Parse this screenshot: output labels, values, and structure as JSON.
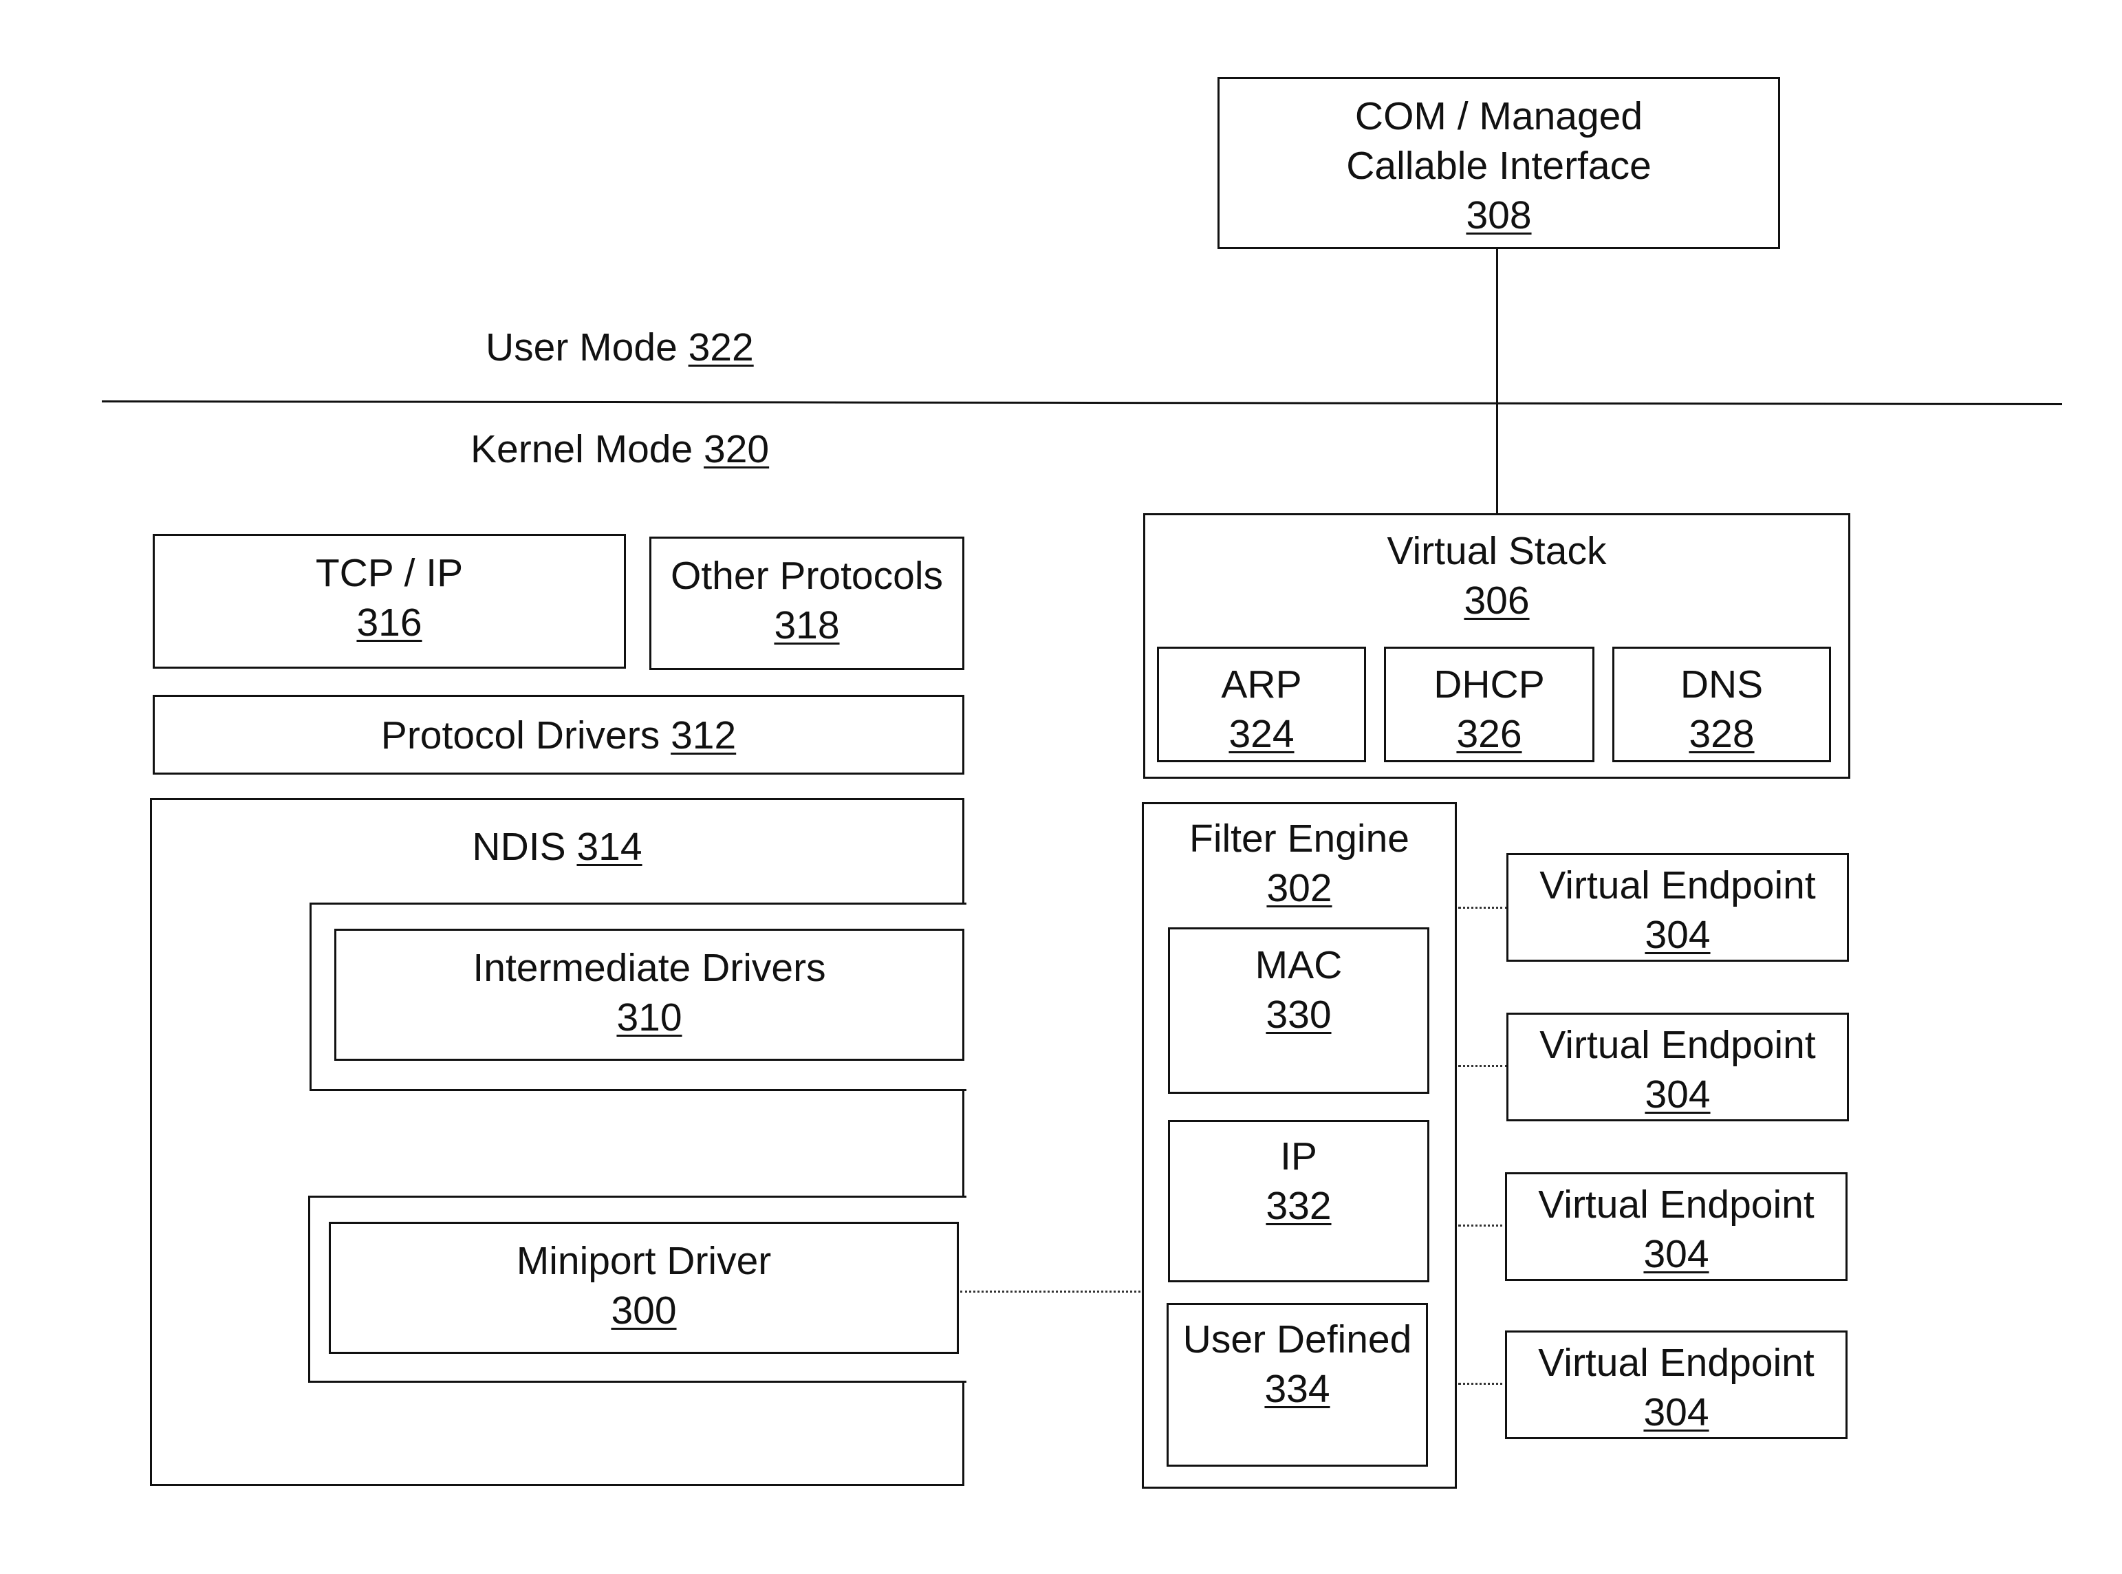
{
  "modes": {
    "user": {
      "label": "User Mode",
      "ref": "322"
    },
    "kernel": {
      "label": "Kernel Mode",
      "ref": "320"
    }
  },
  "com_interface": {
    "line1": "COM / Managed",
    "line2": "Callable Interface",
    "ref": "308"
  },
  "tcpip": {
    "label": "TCP / IP",
    "ref": "316"
  },
  "other_protocols": {
    "label": "Other Protocols",
    "ref": "318"
  },
  "protocol_drivers": {
    "label": "Protocol Drivers",
    "ref": "312"
  },
  "ndis": {
    "label": "NDIS",
    "ref": "314"
  },
  "intermediate_drivers": {
    "label": "Intermediate Drivers",
    "ref": "310"
  },
  "miniport_driver": {
    "label": "Miniport Driver",
    "ref": "300"
  },
  "virtual_stack": {
    "label": "Virtual Stack",
    "ref": "306",
    "components": [
      {
        "label": "ARP",
        "ref": "324"
      },
      {
        "label": "DHCP",
        "ref": "326"
      },
      {
        "label": "DNS",
        "ref": "328"
      }
    ]
  },
  "filter_engine": {
    "label": "Filter Engine",
    "ref": "302",
    "filters": [
      {
        "label": "MAC",
        "ref": "330"
      },
      {
        "label": "IP",
        "ref": "332"
      },
      {
        "label": "User Defined",
        "ref": "334"
      }
    ]
  },
  "virtual_endpoints": [
    {
      "label": "Virtual Endpoint",
      "ref": "304"
    },
    {
      "label": "Virtual Endpoint",
      "ref": "304"
    },
    {
      "label": "Virtual Endpoint",
      "ref": "304"
    },
    {
      "label": "Virtual Endpoint",
      "ref": "304"
    }
  ]
}
